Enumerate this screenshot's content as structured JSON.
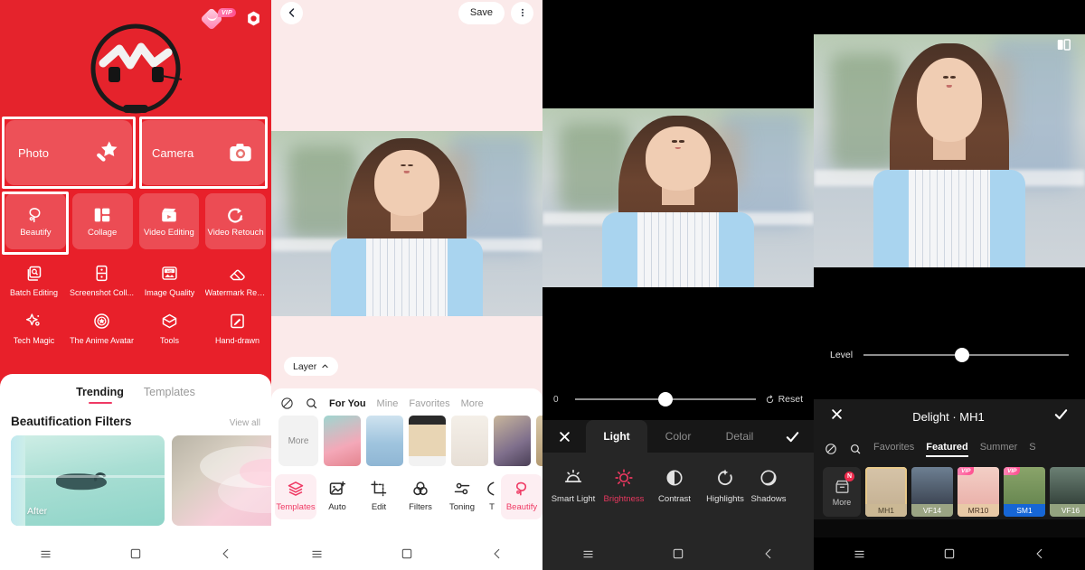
{
  "app": {
    "brand_red": "#e8202a",
    "accent_pink": "#ef3a64",
    "dark_bg": "#000000"
  },
  "panel1_home": {
    "topbar": {
      "vip_badge_label": "VIP",
      "vip_icon": "diamond-smile-icon",
      "settings_icon": "gear-icon"
    },
    "hero": {
      "image_alt": "headphone-product-photo"
    },
    "primary_actions": [
      {
        "label": "Photo",
        "icon": "magic-wand-icon",
        "highlighted": true
      },
      {
        "label": "Camera",
        "icon": "camera-icon",
        "highlighted": true
      }
    ],
    "secondary_actions": [
      {
        "label": "Beautify",
        "icon": "beautify-face-icon",
        "highlighted": true
      },
      {
        "label": "Collage",
        "icon": "collage-grid-icon",
        "highlighted": false
      },
      {
        "label": "Video Editing",
        "icon": "video-clapper-icon",
        "highlighted": false
      },
      {
        "label": "Video Retouch",
        "icon": "video-retouch-icon",
        "highlighted": false
      }
    ],
    "tool_row_1": [
      {
        "label": "Batch Editing",
        "icon": "batch-editing-icon"
      },
      {
        "label": "Screenshot Coll...",
        "icon": "screenshot-collage-icon"
      },
      {
        "label": "Image Quality",
        "icon": "hd-image-icon"
      },
      {
        "label": "Watermark Rem...",
        "icon": "eraser-icon"
      }
    ],
    "tool_row_2": [
      {
        "label": "Tech Magic",
        "icon": "sparkle-icon"
      },
      {
        "label": "The Anime Avatar",
        "icon": "anime-avatar-icon"
      },
      {
        "label": "Tools",
        "icon": "toolbox-icon"
      },
      {
        "label": "Hand-drawn",
        "icon": "hand-drawn-icon"
      }
    ],
    "sheet": {
      "tabs": [
        {
          "label": "Trending",
          "active": true
        },
        {
          "label": "Templates",
          "active": false
        }
      ],
      "section_title": "Beautification Filters",
      "view_all_label": "View all",
      "cards": [
        {
          "badge": "After",
          "alt": "swimmer-in-turquoise-water"
        },
        {
          "badge": "",
          "alt": "pink-peony-flower"
        }
      ]
    },
    "navbar": {
      "menu_icon": "menu-icon",
      "home_icon": "home-square-icon",
      "back_icon": "back-chevron-icon"
    }
  },
  "panel2_editor": {
    "topbar": {
      "back_icon": "back-chevron-icon",
      "save_label": "Save",
      "more_icon": "more-vertical-icon"
    },
    "canvas": {
      "alt": "portrait-of-woman-outdoors"
    },
    "layer_button": {
      "label": "Layer",
      "icon": "chevron-up-icon"
    },
    "filter_bar": {
      "none_icon": "no-filter-icon",
      "search_icon": "search-icon",
      "tabs": [
        {
          "label": "For You",
          "active": true
        },
        {
          "label": "Mine",
          "active": false
        },
        {
          "label": "Favorites",
          "active": false
        },
        {
          "label": "More",
          "active": false
        }
      ]
    },
    "template_strip": {
      "more_label": "More",
      "thumbnails": [
        {
          "alt": "two-girls-pink-template"
        },
        {
          "alt": "seaside-520-template"
        },
        {
          "alt": "yellow-headscarf-template"
        },
        {
          "alt": "white-magazine-template"
        },
        {
          "alt": "bookshelf-template"
        },
        {
          "alt": "beige-collage-template"
        }
      ]
    },
    "toolbar": [
      {
        "label": "Templates",
        "icon": "layers-icon",
        "active": true
      },
      {
        "label": "Auto",
        "icon": "auto-enhance-icon",
        "active": false
      },
      {
        "label": "Edit",
        "icon": "crop-icon",
        "active": false
      },
      {
        "label": "Filters",
        "icon": "three-circles-icon",
        "active": false
      },
      {
        "label": "Toning",
        "icon": "sliders-icon",
        "active": false
      },
      {
        "label": "T",
        "icon": "text-icon",
        "active": false
      },
      {
        "label": "Beautify",
        "icon": "beautify-face-icon",
        "active": true
      }
    ],
    "navbar": {
      "menu_icon": "menu-icon",
      "home_icon": "home-square-icon",
      "back_icon": "back-chevron-icon"
    }
  },
  "panel3_light": {
    "canvas": {
      "alt": "portrait-of-woman-outdoors"
    },
    "slider": {
      "value": "0",
      "reset_label": "Reset",
      "reset_icon": "reset-icon",
      "knob_percent": 50
    },
    "tabs": {
      "cancel_icon": "close-x-icon",
      "confirm_icon": "check-icon",
      "items": [
        {
          "label": "Light",
          "active": true
        },
        {
          "label": "Color",
          "active": false
        },
        {
          "label": "Detail",
          "active": false
        }
      ]
    },
    "tools": [
      {
        "label": "Smart Light",
        "icon": "smart-light-icon",
        "active": false
      },
      {
        "label": "Brightness",
        "icon": "brightness-sun-icon",
        "active": true
      },
      {
        "label": "Contrast",
        "icon": "contrast-half-circle-icon",
        "active": false
      },
      {
        "label": "Highlights",
        "icon": "highlights-icon",
        "active": false
      },
      {
        "label": "Shadows",
        "icon": "shadows-moon-icon",
        "active": false
      }
    ],
    "navbar": {
      "menu_icon": "menu-icon",
      "home_icon": "home-square-icon",
      "back_icon": "back-chevron-icon"
    }
  },
  "panel4_filter": {
    "compare_icon": "compare-before-after-icon",
    "canvas": {
      "alt": "portrait-of-woman-outdoors"
    },
    "level": {
      "label": "Level",
      "knob_percent": 48
    },
    "header": {
      "cancel_icon": "close-x-icon",
      "title": "Delight · MH1",
      "confirm_icon": "check-icon"
    },
    "tabs": {
      "none_icon": "no-filter-icon",
      "search_icon": "search-icon",
      "items": [
        {
          "label": "Favorites",
          "active": false
        },
        {
          "label": "Featured",
          "active": true
        },
        {
          "label": "Summer",
          "active": false
        },
        {
          "label": "S",
          "active": false
        }
      ]
    },
    "filter_strip": {
      "more_label": "More",
      "more_badge": "N",
      "more_icon": "store-download-icon",
      "items": [
        {
          "name": "MH1",
          "vip": false,
          "selected": true
        },
        {
          "name": "VF14",
          "vip": false,
          "selected": false
        },
        {
          "name": "MR10",
          "vip": true,
          "selected": false
        },
        {
          "name": "SM1",
          "vip": true,
          "selected": false
        },
        {
          "name": "VF16",
          "vip": false,
          "selected": false
        }
      ]
    },
    "navbar": {
      "menu_icon": "menu-icon",
      "home_icon": "home-square-icon",
      "back_icon": "back-chevron-icon"
    }
  }
}
